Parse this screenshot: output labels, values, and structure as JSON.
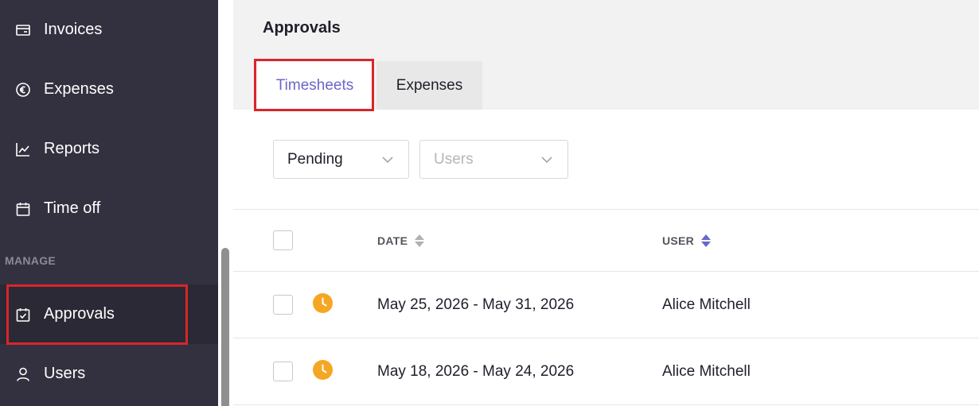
{
  "sidebar": {
    "items": [
      {
        "label": "Invoices",
        "icon": "invoice-icon"
      },
      {
        "label": "Expenses",
        "icon": "euro-icon"
      },
      {
        "label": "Reports",
        "icon": "chart-line-icon"
      },
      {
        "label": "Time off",
        "icon": "calendar-icon"
      },
      {
        "label": "Approvals",
        "icon": "calendar-check-icon",
        "active": true
      },
      {
        "label": "Users",
        "icon": "user-icon"
      }
    ],
    "section_manage": "MANAGE"
  },
  "main": {
    "title": "Approvals",
    "tabs": [
      {
        "label": "Timesheets",
        "active": true
      },
      {
        "label": "Expenses",
        "active": false
      }
    ],
    "filters": {
      "status_value": "Pending",
      "users_placeholder": "Users"
    },
    "table": {
      "columns": [
        "DATE",
        "USER"
      ],
      "rows": [
        {
          "date": "May 25, 2026 - May 31, 2026",
          "user": "Alice Mitchell",
          "status_icon": "pending-clock-icon"
        },
        {
          "date": "May 18, 2026 - May 24, 2026",
          "user": "Alice Mitchell",
          "status_icon": "pending-clock-icon"
        }
      ]
    }
  },
  "colors": {
    "sidebar_bg": "#33313f",
    "accent": "#6b66c9",
    "pending": "#f5a623",
    "highlight": "#d9252a"
  }
}
